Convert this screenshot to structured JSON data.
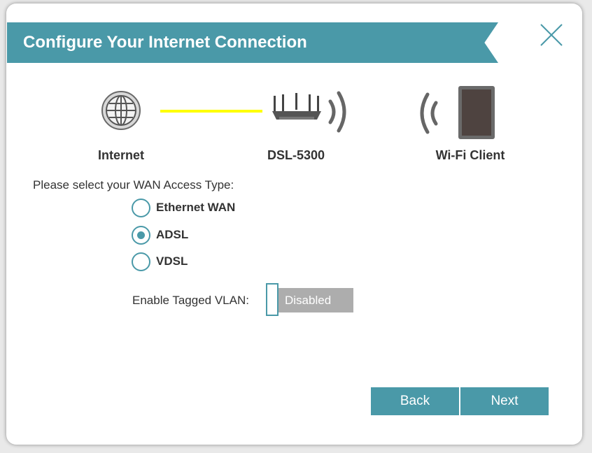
{
  "dialog": {
    "title": "Configure Your Internet Connection",
    "close_icon": "close-icon"
  },
  "diagram": {
    "internet_label": "Internet",
    "router_label": "DSL-5300",
    "client_label": "Wi-Fi Client",
    "link_color": "#ffff00"
  },
  "wan": {
    "prompt": "Please select your WAN Access Type:",
    "options": [
      {
        "label": "Ethernet WAN",
        "selected": false
      },
      {
        "label": "ADSL",
        "selected": true
      },
      {
        "label": "VDSL",
        "selected": false
      }
    ]
  },
  "vlan": {
    "label": "Enable Tagged VLAN:",
    "state": "Disabled"
  },
  "buttons": {
    "back": "Back",
    "next": "Next"
  },
  "colors": {
    "accent": "#4a99a8",
    "toggle_off": "#adadad"
  }
}
